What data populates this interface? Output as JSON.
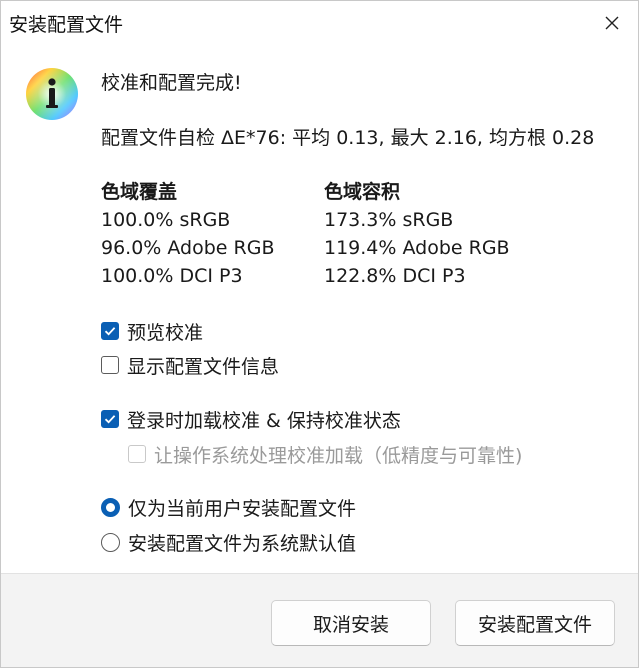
{
  "window": {
    "title": "安装配置文件"
  },
  "icons": {
    "info": "info-icon",
    "close": "close-icon",
    "check": "checkmark-icon"
  },
  "message": {
    "heading": "校准和配置完成!",
    "self_check": "配置文件自检 ΔE*76: 平均 0.13, 最大 2.16, 均方根 0.28"
  },
  "gamut": {
    "coverage": {
      "header": "色域覆盖",
      "rows": [
        "100.0% sRGB",
        "96.0% Adobe RGB",
        "100.0% DCI P3"
      ]
    },
    "volume": {
      "header": "色域容积",
      "rows": [
        "173.3% sRGB",
        "119.4% Adobe RGB",
        "122.8% DCI P3"
      ]
    }
  },
  "options": {
    "preview_calibration": {
      "label": "预览校准",
      "checked": true
    },
    "show_profile_info": {
      "label": "显示配置文件信息",
      "checked": false
    },
    "load_on_login": {
      "label": "登录时加载校准 & 保持校准状态",
      "checked": true
    },
    "os_handles_loading": {
      "label": "让操作系统处理校准加载（低精度与可靠性)",
      "checked": false,
      "disabled": true
    }
  },
  "install_scope": {
    "current_user": {
      "label": "仅为当前用户安装配置文件",
      "selected": true
    },
    "system_default": {
      "label": "安装配置文件为系统默认值",
      "selected": false
    }
  },
  "buttons": {
    "cancel": "取消安装",
    "install": "安装配置文件"
  },
  "colors": {
    "accent": "#0a5fb4",
    "window_bg": "#ffffff",
    "footer_bg": "#f3f3f3",
    "disabled_text": "#9a9a9a"
  }
}
